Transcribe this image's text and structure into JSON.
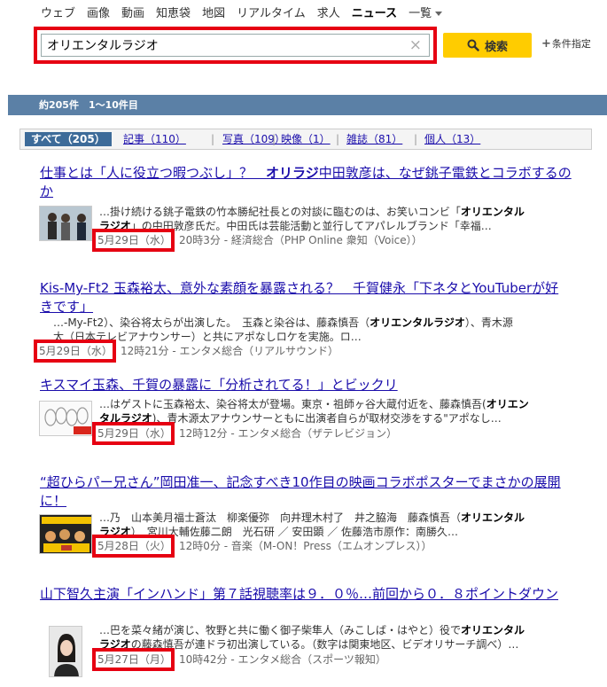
{
  "nav": {
    "items": [
      "ウェブ",
      "画像",
      "動画",
      "知恵袋",
      "地図",
      "リアルタイム",
      "求人",
      "ニュース"
    ],
    "more": "一覧"
  },
  "search": {
    "query": "オリエンタルラジオ",
    "clear_icon": "×",
    "button_label": "検索",
    "conditions": "条件指定"
  },
  "results_summary": "約205件　1〜10件目",
  "filters": {
    "all": "すべて（205）",
    "items": [
      "記事（110）",
      "写真（109）",
      "映像（1）",
      "雑誌（81）",
      "個人（13）"
    ]
  },
  "results": [
    {
      "title_pre": "仕事とは「人に役立つ暇つぶし」？　",
      "title_hl": "オリラジ",
      "title_post": "中田敦彦は、なぜ銚子電鉄とコラボするのか",
      "snippet1_pre": "…掛け続ける銚子電鉄の竹本勝紀社長との対談に臨むのは、お笑いコンビ「",
      "snippet1_hl": "オリエンタル",
      "snippet2_hl": "ラジオ",
      "snippet2_post": "」の中田敦彦氏だ。中田氏は芸能活動と並行してアパレルブランド「幸福…",
      "date": "5月29日（水）",
      "meta": "20時3分 - 経済総合（PHP Online 衆知（Voice））",
      "thumb_icon": "news-photo-icon"
    },
    {
      "title": "Kis-My-Ft2 玉森裕太、意外な素顔を暴露される？　千賀健永「下ネタとYouTuberが好きです」",
      "snippet1_pre": "…-My-Ft2）、染谷将太らが出演した。　玉森と染谷は、藤森慎吾（",
      "snippet1_hl": "オリエンタルラジオ",
      "snippet1_post": "）、青木源",
      "snippet2_post": "太（日本テレビアナウンサー）と共にアポなしロケを実施。ロ…",
      "date": "5月29日（水）",
      "meta": "12時21分 - エンタメ総合（リアルサウンド）"
    },
    {
      "title": "キスマイ玉森、千賀の暴露に「分析されてる！」とビックリ",
      "snippet1_pre": "…はゲストに玉森裕太、染谷将太が登場。東京・祖師ヶ谷大蔵付近を、藤森慎吾(",
      "snippet1_hl": "オリエン",
      "snippet2_hl": "タルラジオ",
      "snippet2_post": ")、青木源太アナウンサーともに出演者自らが取材交渉をする\"アポなし…",
      "date": "5月29日（水）",
      "meta": "12時12分 - エンタメ総合（ザテレビジョン）",
      "thumb_icon": "tv-logo-icon"
    },
    {
      "title": "“超ひらパー兄さん”岡田准一、記念すべき10作目の映画コラボポスターでまさかの展開に！",
      "snippet1_pre": "…乃　山本美月福士蒼汰　柳楽優弥　向井理木村了　井之脇海　藤森慎吾（",
      "snippet1_hl": "オリエンタル",
      "snippet2_hl": "ラジオ",
      "snippet2_post": "）　宮川大輔佐藤二朗　光石研 ／ 安田顕 ／ 佐藤浩市原作：南勝久…",
      "date": "5月28日（火）",
      "meta": "12時0分 - 音楽（M-ON！Press（エムオンプレス））",
      "thumb_icon": "movie-poster-icon"
    },
    {
      "title": "山下智久主演「インハンド」第７話視聴率は９．０％…前回から０．８ポイントダウン",
      "snippet1_pre": "…巴を菜々緒が演じ、牧野と共に働く御子柴隼人（みこしば・はやと）役で",
      "snippet1_hl": "オリエンタル",
      "snippet2_hl": "ラジオ",
      "snippet2_post": "の藤森慎吾が連ドラ初出演している。（数字は関東地区、ビデオリサーチ調べ）…",
      "date": "5月27日（月）",
      "meta": "10時42分 - エンタメ総合（スポーツ報知）",
      "thumb_icon": "portrait-photo-icon"
    }
  ],
  "colors": {
    "link": "#1a0dab",
    "highlight_box": "#e60012",
    "search_button": "#ffcc00",
    "results_bar": "#5b80a6",
    "filter_active": "#3d6b99"
  }
}
